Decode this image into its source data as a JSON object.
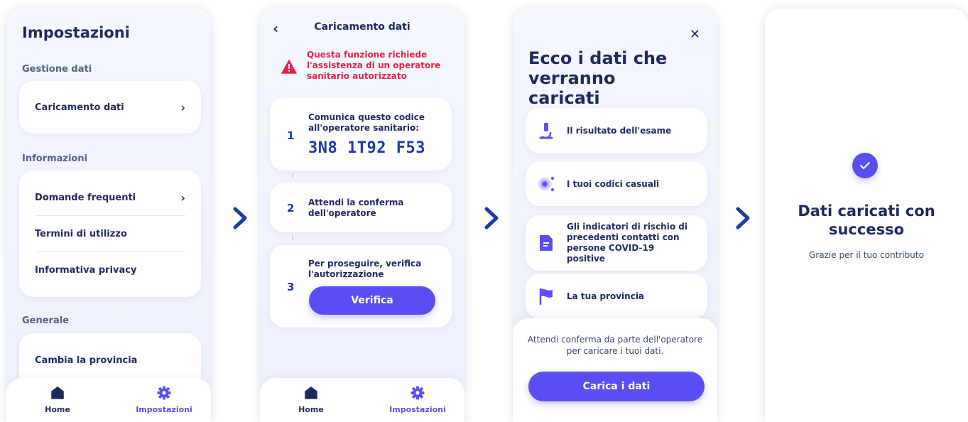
{
  "screen1": {
    "title": "Impostazioni",
    "sections": [
      {
        "label": "Gestione dati",
        "items": [
          {
            "label": "Caricamento dati",
            "chevron": true
          }
        ]
      },
      {
        "label": "Informazioni",
        "items": [
          {
            "label": "Domande frequenti",
            "chevron": true
          },
          {
            "label": "Termini di utilizzo",
            "chevron": false
          },
          {
            "label": "Informativa privacy",
            "chevron": false
          }
        ]
      },
      {
        "label": "Generale",
        "items": [
          {
            "label": "Cambia la provincia",
            "chevron": false
          }
        ]
      }
    ]
  },
  "screen2": {
    "title": "Caricamento dati",
    "warning": "Questa funzione richiede l'assistenza di un operatore sanitario autorizzato",
    "steps": [
      {
        "num": "1",
        "text": "Comunica questo codice all'operatore sanitario:",
        "code": "3N8 1T92 F53"
      },
      {
        "num": "2",
        "text": "Attendi la conferma dell'operatore"
      },
      {
        "num": "3",
        "text": "Per proseguire, verifica l'autorizzazione",
        "button": "Verifica"
      }
    ]
  },
  "screen3": {
    "title": "Ecco i dati che verranno caricati",
    "items": [
      {
        "icon": "microscope-icon",
        "label": "Il risultato dell'esame"
      },
      {
        "icon": "broadcast-icon",
        "label": "I tuoi codici casuali"
      },
      {
        "icon": "document-icon",
        "label": "Gli indicatori di rischio di precedenti contatti con persone COVID-19 positive"
      },
      {
        "icon": "flag-icon",
        "label": "La tua provincia"
      }
    ],
    "sheet_text": "Attendi conferma da parte dell'operatore per caricare i tuoi dati.",
    "button": "Carica i dati"
  },
  "screen4": {
    "title": "Dati caricati con successo",
    "subtitle": "Grazie per il tuo contributo"
  },
  "tabbar": {
    "home": "Home",
    "settings": "Impostazioni"
  },
  "colors": {
    "accent": "#5a4ef5",
    "dark": "#1f2a5c",
    "warning": "#e8224a",
    "arrow": "#1c3aa6"
  }
}
